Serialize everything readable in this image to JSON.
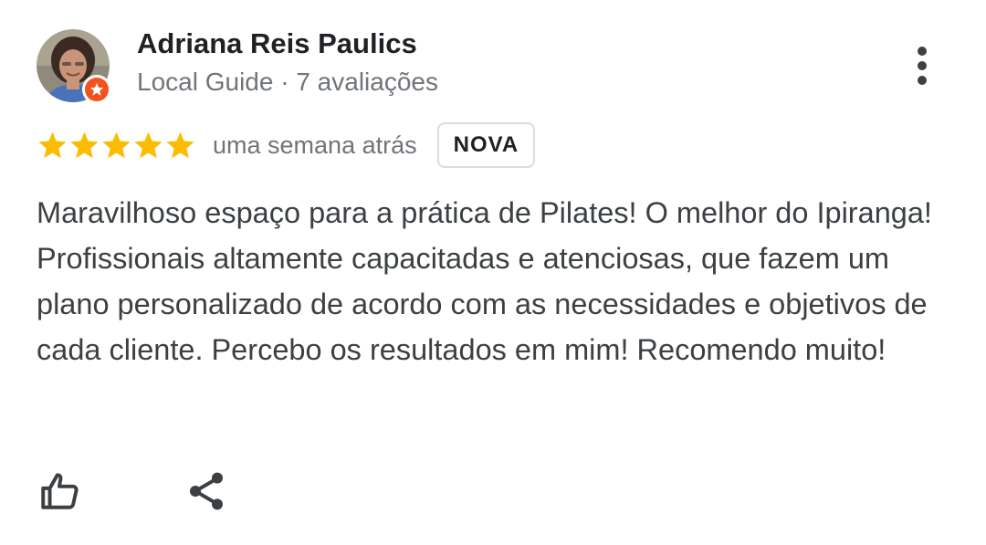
{
  "author": {
    "name": "Adriana Reis Paulics",
    "meta": "Local Guide · 7 avaliações",
    "avatar_icon": "user-photo",
    "badge_icon": "local-guide-star-icon",
    "badge_color": "#f4511e"
  },
  "rating": {
    "stars": 5,
    "max": 5,
    "star_color": "#fbbc04",
    "date": "uma semana atrás",
    "badge": "NOVA"
  },
  "review": {
    "text": "Maravilhoso espaço para a prática de Pilates! O melhor do Ipiranga! Profissionais altamente capacitadas e atenciosas, que fazem um plano personalizado de acordo com as necessidades e objetivos de cada cliente. Percebo os resultados em mim! Recomendo muito!"
  },
  "actions": {
    "more_icon": "more-vertical-icon",
    "like_icon": "thumbs-up-icon",
    "share_icon": "share-icon"
  },
  "colors": {
    "text_primary": "#202124",
    "text_secondary": "#70757a",
    "body_text": "#3c4043",
    "icon": "#3c4043",
    "border": "#dadce0"
  }
}
